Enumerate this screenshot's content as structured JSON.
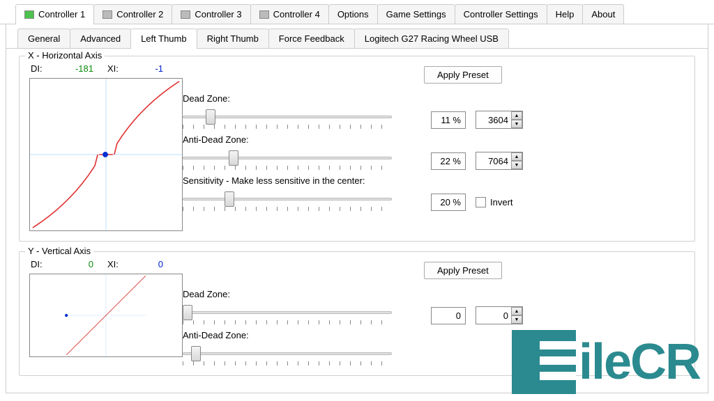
{
  "main_tabs": [
    {
      "label": "Controller 1",
      "active": true,
      "led": "green"
    },
    {
      "label": "Controller 2",
      "led": "gray"
    },
    {
      "label": "Controller 3",
      "led": "gray"
    },
    {
      "label": "Controller 4",
      "led": "gray"
    },
    {
      "label": "Options"
    },
    {
      "label": "Game Settings"
    },
    {
      "label": "Controller Settings"
    },
    {
      "label": "Help"
    },
    {
      "label": "About"
    }
  ],
  "sub_tabs": [
    {
      "label": "General"
    },
    {
      "label": "Advanced"
    },
    {
      "label": "Left Thumb",
      "active": true
    },
    {
      "label": "Right Thumb"
    },
    {
      "label": "Force Feedback"
    },
    {
      "label": "Logitech G27 Racing Wheel USB"
    }
  ],
  "x_axis": {
    "title": "X - Horizontal Axis",
    "di_label": "DI:",
    "di_value": "-181",
    "xi_label": "XI:",
    "xi_value": "-1",
    "apply_preset": "Apply Preset",
    "deadzone_label": "Dead Zone:",
    "deadzone_pct": "11 %",
    "deadzone_raw": "3604",
    "antideadzone_label": "Anti-Dead Zone:",
    "antideadzone_pct": "22 %",
    "antideadzone_raw": "7064",
    "sensitivity_label": "Sensitivity - Make less sensitive in the center:",
    "sensitivity_pct": "20 %",
    "invert_label": "Invert",
    "slider_positions": {
      "dead": 11,
      "anti": 22,
      "sens": 20
    }
  },
  "y_axis": {
    "title": "Y - Vertical Axis",
    "di_label": "DI:",
    "di_value": "0",
    "xi_label": "XI:",
    "xi_value": "0",
    "apply_preset": "Apply Preset",
    "deadzone_label": "Dead Zone:",
    "deadzone_pct": "0",
    "deadzone_raw": "0",
    "antideadzone_label": "Anti-Dead Zone:",
    "antideadzone_pct": "4"
  },
  "watermark": "ileCR"
}
